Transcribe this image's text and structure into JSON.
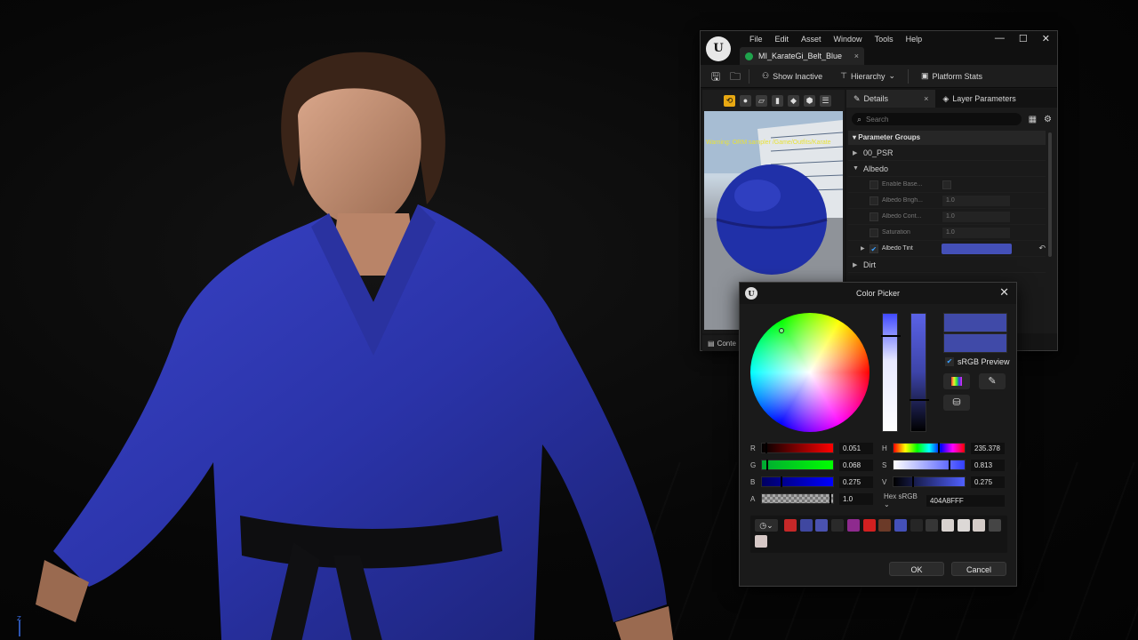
{
  "material_editor": {
    "menu": [
      "File",
      "Edit",
      "Asset",
      "Window",
      "Tools",
      "Help"
    ],
    "window_controls": [
      "—",
      "☐",
      "✕"
    ],
    "asset_tab": "MI_KarateGi_Belt_Blue",
    "toolbar": {
      "show_inactive": "Show Inactive",
      "hierarchy": "Hierarchy",
      "platform_stats": "Platform Stats"
    },
    "viewport_warning": "Warning: ORM sampler /Game/Outfits/Karate",
    "details": {
      "tabs": [
        "Details",
        "Layer Parameters"
      ],
      "search_placeholder": "Search",
      "parameter_groups_label": "Parameter Groups",
      "categories": [
        "00_PSR",
        "Albedo",
        "Dirt"
      ],
      "albedo_props": [
        {
          "name": "Enable Base...",
          "value": ""
        },
        {
          "name": "Albedo Brigh...",
          "value": "1.0"
        },
        {
          "name": "Albedo Cont...",
          "value": "1.0"
        },
        {
          "name": "Saturation",
          "value": "1.0"
        }
      ],
      "albedo_tint": {
        "name": "Albedo Tint",
        "color": "#4450b8"
      }
    },
    "content_tab": "Conte"
  },
  "color_picker": {
    "title": "Color Picker",
    "close": "✕",
    "new_color": "#404aa8",
    "old_color": "#404aa8",
    "srgb_preview_label": "sRGB Preview",
    "rgba": [
      {
        "label": "R",
        "value": "0.051",
        "fraction": 0.051
      },
      {
        "label": "G",
        "value": "0.068",
        "fraction": 0.068
      },
      {
        "label": "B",
        "value": "0.275",
        "fraction": 0.275
      },
      {
        "label": "A",
        "value": "1.0",
        "fraction": 1.0
      }
    ],
    "hsv": [
      {
        "label": "H",
        "value": "235.378",
        "fraction": 0.654
      },
      {
        "label": "S",
        "value": "0.813",
        "fraction": 0.813
      },
      {
        "label": "V",
        "value": "0.275",
        "fraction": 0.275
      }
    ],
    "hex_label": "Hex sRGB",
    "hex_value": "404A8FFF",
    "recent_colors": [
      "#c62828",
      "#3f47a0",
      "#4a52b0",
      "#2a2a2a",
      "#8e2a8e",
      "#d22020",
      "#6b3a28",
      "#4450b8",
      "#262626",
      "#363636",
      "#d8d2cf",
      "#dcd8d6",
      "#d4ccc8",
      "#454545",
      "#d6c8c6"
    ],
    "ok_label": "OK",
    "cancel_label": "Cancel"
  }
}
